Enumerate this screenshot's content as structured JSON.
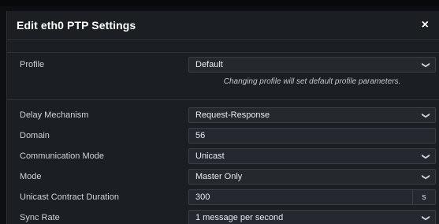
{
  "modal": {
    "title": "Edit eth0 PTP Settings",
    "close_symbol": "×"
  },
  "fields": {
    "profile": {
      "label": "Profile",
      "value": "Default"
    },
    "profile_note": "Changing profile will set default profile parameters.",
    "delay_mechanism": {
      "label": "Delay Mechanism",
      "value": "Request-Response"
    },
    "domain": {
      "label": "Domain",
      "value": "56"
    },
    "communication_mode": {
      "label": "Communication Mode",
      "value": "Unicast"
    },
    "mode": {
      "label": "Mode",
      "value": "Master Only"
    },
    "unicast_contract_duration": {
      "label": "Unicast Contract Duration",
      "value": "300",
      "unit": "s"
    },
    "sync_rate": {
      "label": "Sync Rate",
      "value": "1 message per second"
    }
  },
  "icons": {
    "dropdown": "chevron-down-icon",
    "close": "close-icon"
  },
  "colors": {
    "background": "#1b1e23",
    "input": "#25292f",
    "text": "#e8ecf0"
  }
}
